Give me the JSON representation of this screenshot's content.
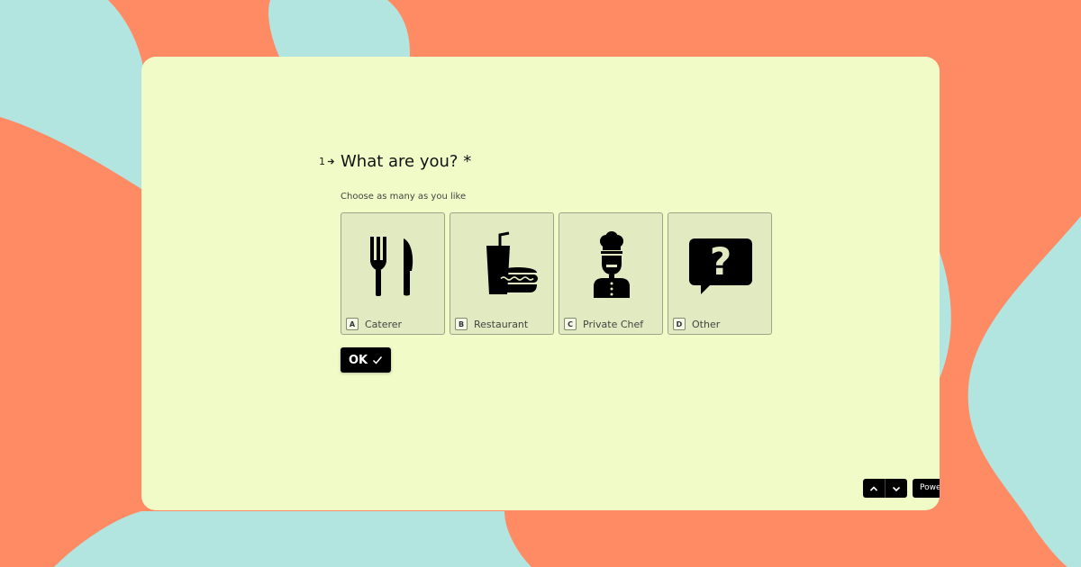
{
  "colors": {
    "background": "#ff8b65",
    "blob": "#b2e4e0",
    "card": "#f1fbc7",
    "option_fill": "#e1eac0",
    "option_border": "#9aa58a",
    "button": "#000000"
  },
  "question": {
    "number": "1",
    "title": "What are you? *",
    "hint": "Choose as many as you like",
    "options": [
      {
        "key": "A",
        "label": "Caterer",
        "icon": "fork-knife-icon"
      },
      {
        "key": "B",
        "label": "Restaurant",
        "icon": "fast-food-icon"
      },
      {
        "key": "C",
        "label": "Private Chef",
        "icon": "chef-icon"
      },
      {
        "key": "D",
        "label": "Other",
        "icon": "question-bubble-icon"
      }
    ]
  },
  "ok_button": {
    "label": "OK"
  },
  "footer": {
    "powered_label": "Powered by Typeform"
  }
}
